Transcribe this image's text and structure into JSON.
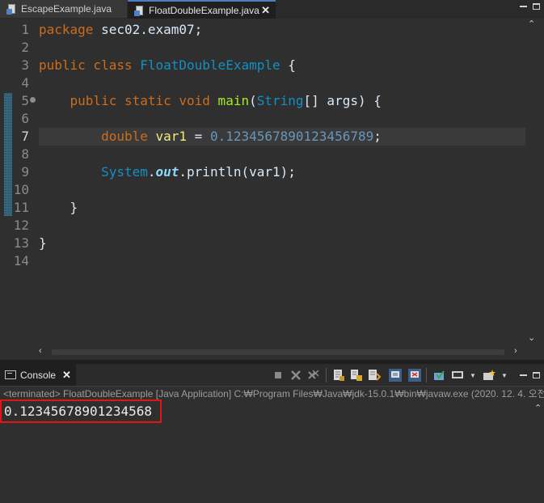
{
  "tabs": [
    {
      "label": "EscapeExample.java",
      "active": false
    },
    {
      "label": "FloatDoubleExample.java",
      "active": true,
      "close": "✕"
    }
  ],
  "editor": {
    "line_numbers": [
      "1",
      "2",
      "3",
      "4",
      "5",
      "6",
      "7",
      "8",
      "9",
      "10",
      "11",
      "12",
      "13",
      "14"
    ],
    "current_line": "7",
    "code": {
      "l1_kw": "package",
      "l1_rest": " sec02.exam07;",
      "l3_kw": "public class",
      "l3_cls": " FloatDoubleExample",
      "l3_rest": " {",
      "l5_indent": "    ",
      "l5_kw": "public static void",
      "l5_mth": " main",
      "l5_p1": "(",
      "l5_cls": "String",
      "l5_p2": "[] args) {",
      "l7_indent": "        ",
      "l7_kw": "double",
      "l7_var": " var1",
      "l7_eq": " = ",
      "l7_num": "0.1234567890123456789",
      "l7_end": ";",
      "l9_indent": "        ",
      "l9_cls": "System",
      "l9_dot": ".",
      "l9_fld": "out",
      "l9_rest": ".println(var1);",
      "l11": "    }",
      "l13": "}"
    }
  },
  "console": {
    "tab_label": "Console",
    "close": "✕",
    "status": "<terminated> FloatDoubleExample [Java Application] C:₩Program Files₩Java₩jdk-15.0.1₩bin₩javaw.exe  (2020. 12. 4. 오전",
    "output": "0.12345678901234568"
  },
  "icons": [
    "java-file-icon",
    "close-icon",
    "minimize-icon",
    "maximize-icon",
    "console-icon",
    "terminate-icon",
    "remove-launch-icon",
    "remove-all-icon",
    "clear-console-icon",
    "scroll-lock-icon",
    "word-wrap-icon",
    "show-stdout-icon",
    "show-stderr-icon",
    "pin-console-icon",
    "display-console-icon",
    "new-console-icon"
  ],
  "colors": {
    "keyword": "#cc6c1d",
    "class": "#1290c3",
    "method": "#a7ec21",
    "number": "#6897bb",
    "variable": "#f3ec79",
    "highlight_box": "#e01515"
  }
}
